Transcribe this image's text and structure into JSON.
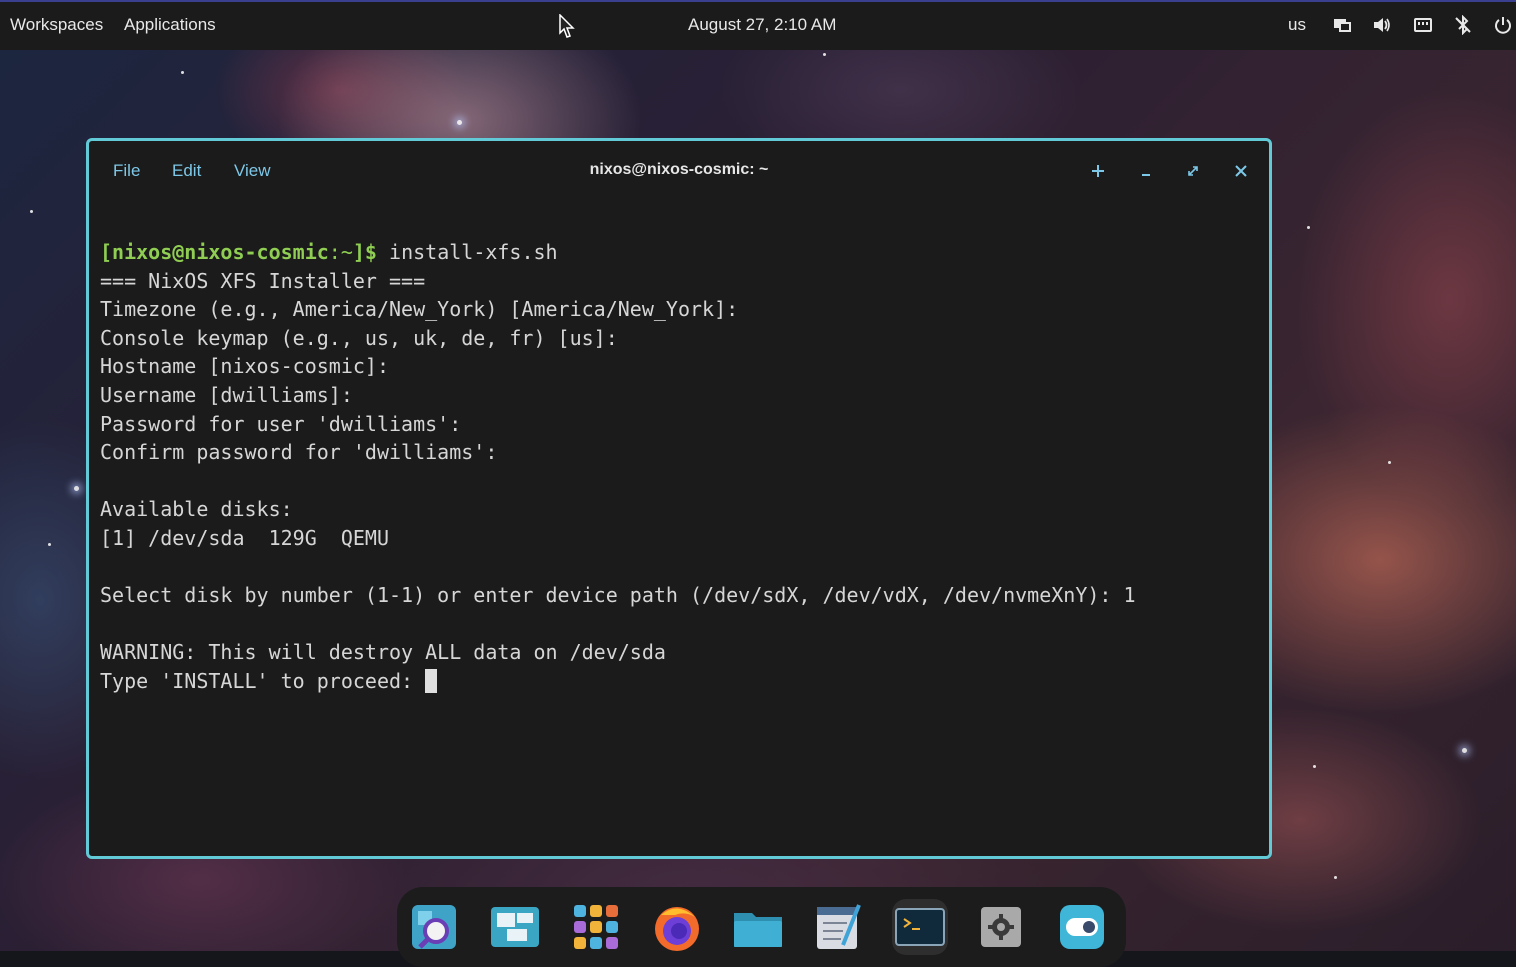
{
  "top_panel": {
    "workspaces_label": "Workspaces",
    "applications_label": "Applications",
    "clock": "August 27, 2:10 AM",
    "keyboard_layout": "us",
    "icons": [
      "display-icon",
      "volume-icon",
      "network-icon",
      "bluetooth-off-icon",
      "power-icon"
    ]
  },
  "terminal": {
    "title": "nixos@nixos-cosmic: ~",
    "menu": {
      "file": "File",
      "edit": "Edit",
      "view": "View"
    },
    "controls": [
      "new-tab-icon",
      "minimize-icon",
      "maximize-icon",
      "close-icon"
    ],
    "prompt": {
      "open": "[",
      "user_host": "nixos@nixos-cosmic",
      "path": ":~",
      "close": "]$",
      "command": " install-xfs.sh"
    },
    "lines": [
      "=== NixOS XFS Installer ===",
      "Timezone (e.g., America/New_York) [America/New_York]:",
      "Console keymap (e.g., us, uk, de, fr) [us]:",
      "Hostname [nixos-cosmic]:",
      "Username [dwilliams]:",
      "Password for user 'dwilliams':",
      "Confirm password for 'dwilliams':",
      "",
      "Available disks:",
      "[1] /dev/sda  129G  QEMU",
      "",
      "Select disk by number (1-1) or enter device path (/dev/sdX, /dev/vdX, /dev/nvmeXnY): 1",
      "",
      "WARNING: This will destroy ALL data on /dev/sda"
    ],
    "input_prompt": "Type 'INSTALL' to proceed: ",
    "accent_color": "#62c9d6"
  },
  "dock": {
    "items": [
      "launcher-search-icon",
      "workspaces-overview-icon",
      "app-grid-icon",
      "firefox-icon",
      "files-folder-icon",
      "text-editor-icon",
      "terminal-icon",
      "settings-icon",
      "toggle-app-icon"
    ],
    "active_item": "terminal-icon"
  }
}
